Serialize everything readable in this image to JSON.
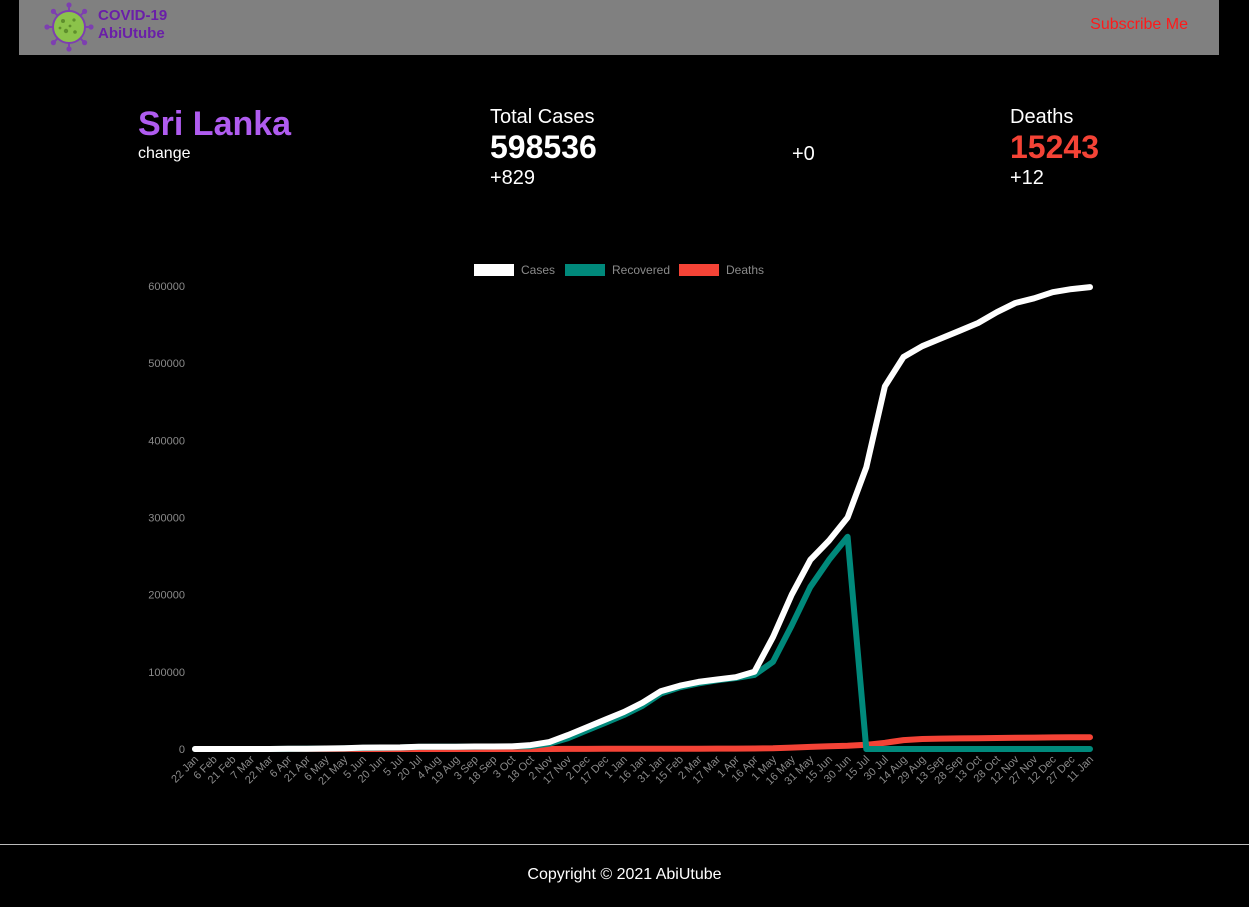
{
  "brand": {
    "line1": "COVID-19",
    "line2": "AbiUtube",
    "icon": "virus-icon"
  },
  "nav": {
    "subscribe_label": "Subscribe Me"
  },
  "colors": {
    "accent": "#b05cf0",
    "cases": "#ffffff",
    "recovered": "#00897b",
    "deaths": "#f44336",
    "subscribe": "#ff1a1a"
  },
  "summary": {
    "country": "Sri Lanka",
    "change_label": "change",
    "total_cases_label": "Total Cases",
    "total_cases": "598536",
    "total_cases_delta": "+829",
    "recovered_delta": "+0",
    "deaths_label": "Deaths",
    "deaths": "15243",
    "deaths_delta": "+12"
  },
  "chart_data": {
    "type": "line",
    "categories": [
      "22 Jan",
      "6 Feb",
      "21 Feb",
      "7 Mar",
      "22 Mar",
      "6 Apr",
      "21 Apr",
      "6 May",
      "21 May",
      "5 Jun",
      "20 Jun",
      "5 Jul",
      "20 Jul",
      "4 Aug",
      "19 Aug",
      "3 Sep",
      "18 Sep",
      "3 Oct",
      "18 Oct",
      "2 Nov",
      "17 Nov",
      "2 Dec",
      "17 Dec",
      "1 Jan",
      "16 Jan",
      "31 Jan",
      "15 Feb",
      "2 Mar",
      "17 Mar",
      "1 Apr",
      "16 Apr",
      "1 May",
      "16 May",
      "31 May",
      "15 Jun",
      "30 Jun",
      "15 Jul",
      "30 Jul",
      "14 Aug",
      "29 Aug",
      "13 Sep",
      "28 Sep",
      "13 Oct",
      "28 Oct",
      "12 Nov",
      "27 Nov",
      "12 Dec",
      "27 Dec",
      "11 Jan"
    ],
    "yticks": [
      0,
      100000,
      200000,
      300000,
      400000,
      500000,
      600000
    ],
    "ylim": [
      0,
      600000
    ],
    "grid": false,
    "legend_position": "top",
    "series": [
      {
        "name": "Cases",
        "color": "#ffffff",
        "values": [
          0,
          0,
          0,
          0,
          0,
          200,
          300,
          700,
          1100,
          1800,
          2000,
          2100,
          2800,
          2900,
          3000,
          3200,
          3300,
          3400,
          5000,
          9000,
          18000,
          28000,
          38000,
          48000,
          60000,
          75000,
          82000,
          87000,
          90000,
          93000,
          100000,
          145000,
          200000,
          245000,
          270000,
          300000,
          365000,
          470000,
          508000,
          522000,
          532000,
          542000,
          552000,
          566000,
          578000,
          584000,
          592000,
          596000,
          598536
        ]
      },
      {
        "name": "Recovered",
        "color": "#00897b",
        "values": [
          0,
          0,
          0,
          0,
          0,
          100,
          200,
          500,
          800,
          1400,
          1700,
          1900,
          2700,
          2800,
          2900,
          3000,
          3100,
          3200,
          3600,
          7000,
          14000,
          24000,
          34000,
          44000,
          56000,
          72000,
          80000,
          85000,
          89000,
          92000,
          96000,
          113000,
          160000,
          210000,
          245000,
          275000,
          0,
          0,
          0,
          0,
          0,
          0,
          0,
          0,
          0,
          0,
          0,
          0,
          0
        ]
      },
      {
        "name": "Deaths",
        "color": "#f44336",
        "values": [
          0,
          0,
          0,
          0,
          0,
          7,
          7,
          9,
          10,
          11,
          11,
          11,
          11,
          12,
          12,
          12,
          12,
          13,
          19,
          50,
          100,
          150,
          200,
          250,
          300,
          350,
          400,
          450,
          500,
          550,
          650,
          900,
          1800,
          2700,
          3500,
          4200,
          5500,
          8000,
          11500,
          13000,
          13500,
          13800,
          14000,
          14200,
          14500,
          14800,
          15000,
          15100,
          15243
        ]
      }
    ]
  },
  "footer": {
    "copyright": "Copyright © 2021 AbiUtube"
  }
}
